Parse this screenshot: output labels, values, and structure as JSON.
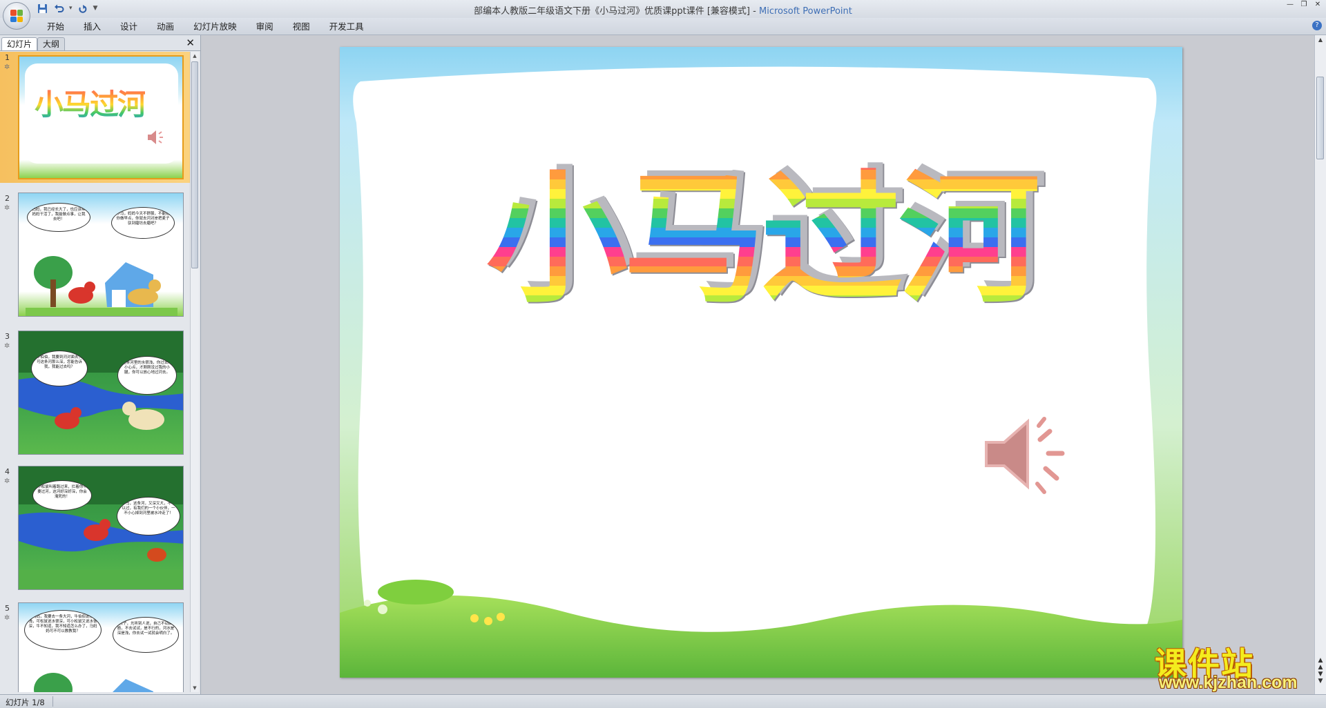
{
  "window": {
    "title": "部编本人教版二年级语文下册《小马过河》优质课ppt课件 [兼容模式]",
    "title_sep": " - ",
    "app_name": "Microsoft PowerPoint",
    "controls": [
      "minimize-icon",
      "restore-icon",
      "close-icon"
    ]
  },
  "quick_access": {
    "save": "save-icon",
    "undo": "undo-icon",
    "redo": "redo-icon",
    "customize": "▼"
  },
  "ribbon": {
    "tabs": [
      "开始",
      "插入",
      "设计",
      "动画",
      "幻灯片放映",
      "审阅",
      "视图",
      "开发工具"
    ],
    "help": "?"
  },
  "pane": {
    "tabs": [
      "幻灯片",
      "大纲"
    ],
    "close": "✕",
    "slides": [
      {
        "num": "1",
        "title": "小马过河",
        "selected": true
      },
      {
        "num": "2",
        "bubble_left": "妈妈，我已经长大了，也应该帮妈妈干活了，我能做点事，让我去吧！",
        "bubble_right": "小马，妈妈今天不舒服，不能给你做早点，你就去河对岸把麦子驮到磨坊去磨吧？"
      },
      {
        "num": "3",
        "bubble_left": "牛伯伯，我要到河对面去，可这条河那么深，您能告诉我，我能过去吗？",
        "bubble_right": "这条河里的水很浅，你过去时小心点，才刚刚没过我的小腿，你可以放心地过河去。"
      },
      {
        "num": "4",
        "bubble_left": "小松鼠叫着跑过来，拦着你不要过河，这河好深好深，你会淹死的！",
        "bubble_right": "小马，这条河，又深又大，不可以过，有我们的一个小伙伴，一不小心掉到河里被水冲走了！"
      },
      {
        "num": "5",
        "bubble_left": "马妈妈，我要去一条大河，牛伯伯说水很浅，可松鼠说水很深，可小松鼠又说水很深，牛不知道，我不知道怎么办了，马妈妈可不可以教教我？",
        "bubble_right": "孩子，光听别人说，自己不动脑筋，不去试试，是不行的，河水是深是浅，你去试一试就会明白了。"
      }
    ]
  },
  "slide": {
    "title": "小马过河",
    "speaker_icon": "speaker-icon"
  },
  "status": {
    "slide_indicator": "幻灯片 1/8"
  },
  "watermark": {
    "cn": "课件站",
    "url": "www.kjzhan.com"
  },
  "colors": {
    "selection": "#f6c05f",
    "title_gradient": [
      "#ff3f8e",
      "#ff9b3d",
      "#fff23b",
      "#53d05e",
      "#29a6e8",
      "#3b6ff0"
    ],
    "app_name": "#3f6fb5"
  }
}
